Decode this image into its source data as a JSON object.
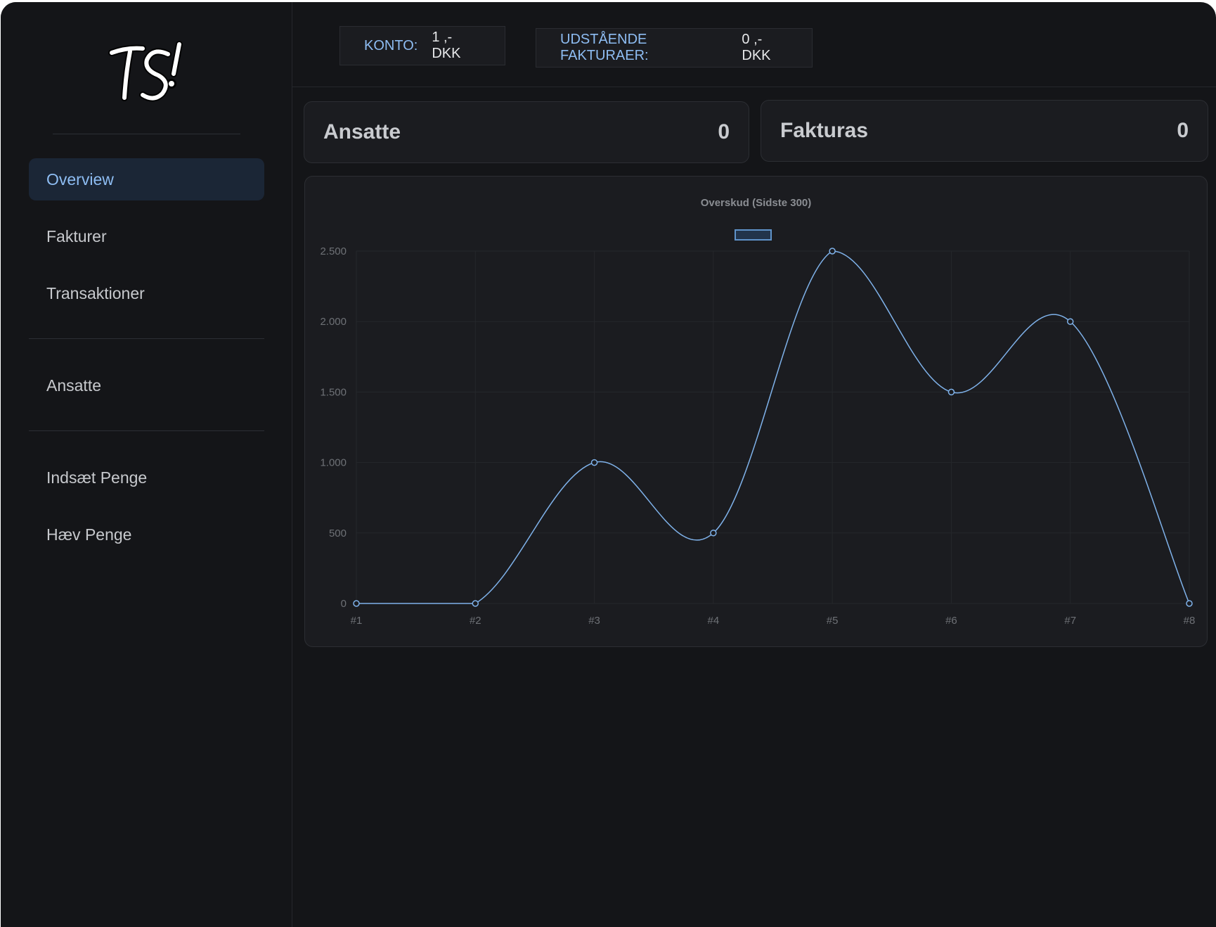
{
  "sidebar": {
    "logo_text": "TS!",
    "items": [
      {
        "label": "Overview",
        "active": true
      },
      {
        "label": "Fakturer",
        "active": false
      },
      {
        "label": "Transaktioner",
        "active": false
      },
      {
        "label": "Ansatte",
        "active": false
      },
      {
        "label": "Indsæt Penge",
        "active": false
      },
      {
        "label": "Hæv Penge",
        "active": false
      }
    ]
  },
  "header": {
    "account_label": "KONTO:",
    "account_value": "1 ,-DKK",
    "outstanding_label": "UDSTÅENDE FAKTURAER:",
    "outstanding_value": "0 ,-DKK"
  },
  "stats": {
    "employees_label": "Ansatte",
    "employees_value": "0",
    "invoices_label": "Fakturas",
    "invoices_value": "0"
  },
  "chart_data": {
    "type": "line",
    "title": "Overskud (Sidste 300)",
    "categories": [
      "#1",
      "#2",
      "#3",
      "#4",
      "#5",
      "#6",
      "#7",
      "#8"
    ],
    "series": [
      {
        "values": [
          0,
          0,
          1000,
          500,
          2500,
          1500,
          2000,
          0
        ]
      }
    ],
    "ylim": [
      0,
      2500
    ],
    "yticks": [
      0,
      500,
      1000,
      1500,
      2000,
      2500
    ],
    "ytick_labels": [
      "0",
      "500",
      "1.000",
      "1.500",
      "2.000",
      "2.500"
    ],
    "grid": true,
    "legend": "top-center",
    "line_color": "#7fb2ea",
    "grid_color": "#25272b",
    "tick_color": "#6e7176"
  },
  "colors": {
    "background": "#141518",
    "card": "#1b1c20",
    "accent": "#8ebdf3",
    "active_nav_bg": "#1b2636"
  }
}
